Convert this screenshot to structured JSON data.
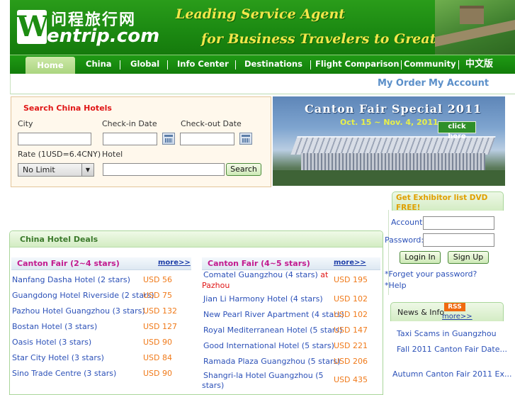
{
  "header": {
    "logo_cn": "问程旅行网",
    "logo_en": "entrip.com",
    "logo_mark": "W",
    "slogan_line1": "Leading Service Agent",
    "slogan_line2": "for Business Travelers to Greater China"
  },
  "nav": {
    "items": [
      "Home",
      "China",
      "Global",
      "Info Center",
      "Destinations",
      "Flight Comparison",
      "Community",
      "中文版"
    ]
  },
  "subnav": {
    "my_order": "My Order",
    "my_account": "My Account"
  },
  "search": {
    "title": "Search China Hotels",
    "city_label": "City",
    "checkin_label": "Check-in Date",
    "checkout_label": "Check-out Date",
    "rate_label": "Rate (1USD=6.4CNY)",
    "hotel_label": "Hotel",
    "rate_selected": "No Limit",
    "search_button": "Search"
  },
  "banner": {
    "title": "Canton Fair Special 2011",
    "dates": "Oct. 15 ~ Nov. 4, 2011",
    "click_here": "click here"
  },
  "deals": {
    "title": "China Hotel Deals",
    "columns": [
      {
        "heading": "Canton Fair (2~4 stars)",
        "more": "more>>",
        "hotels": [
          {
            "name": "Nanfang Dasha Hotel (2 stars)",
            "price": "USD 56"
          },
          {
            "name": "Guangdong Hotel Riverside (2 stars)",
            "price": "USD 75"
          },
          {
            "name": "Pazhou Hotel Guangzhou (3 stars)",
            "price": "USD 132"
          },
          {
            "name": "Bostan Hotel (3 stars)",
            "price": "USD 127"
          },
          {
            "name": "Oasis Hotel (3 stars)",
            "price": "USD 90"
          },
          {
            "name": "Star City Hotel (3 stars)",
            "price": "USD 84"
          },
          {
            "name": "Sino Trade Centre (3 stars)",
            "price": "USD 90"
          }
        ]
      },
      {
        "heading": "Canton Fair (4~5 stars)",
        "more": "more>>",
        "hotels": [
          {
            "name": "Comatel Guangzhou (4 stars)",
            "loc_prefix": " at",
            "loc": "Pazhou",
            "price": "USD 195"
          },
          {
            "name": "Jian Li Harmony Hotel (4 stars)",
            "price": "USD 102"
          },
          {
            "name": "New Pearl River Apartment (4 stars)",
            "price": "USD 102"
          },
          {
            "name": "Royal Mediterranean Hotel (5 stars)",
            "price": "USD 147"
          },
          {
            "name": "Good International Hotel (5 stars)",
            "price": "USD 221"
          },
          {
            "name": "Ramada Plaza Guangzhou (5 stars)",
            "price": "USD 206"
          },
          {
            "name": "Shangri-la Hotel Guangzhou (5",
            "name2": "stars)",
            "price": "USD 435"
          }
        ]
      }
    ]
  },
  "login": {
    "title": "Get Exhibitor list DVD FREE!",
    "account_label": "Account:",
    "password_label": "Password:",
    "login_button": "Login In",
    "signup_button": "Sign Up",
    "forgot_link": "*Forget your password?",
    "help_link": "*Help"
  },
  "news": {
    "title": "News & Info",
    "rss": "RSS",
    "more": "more>>",
    "items": [
      "Taxi Scams in Guangzhou",
      "Fall 2011 Canton Fair Date...",
      "Autumn Canton Fair 2011 Ex..."
    ]
  }
}
